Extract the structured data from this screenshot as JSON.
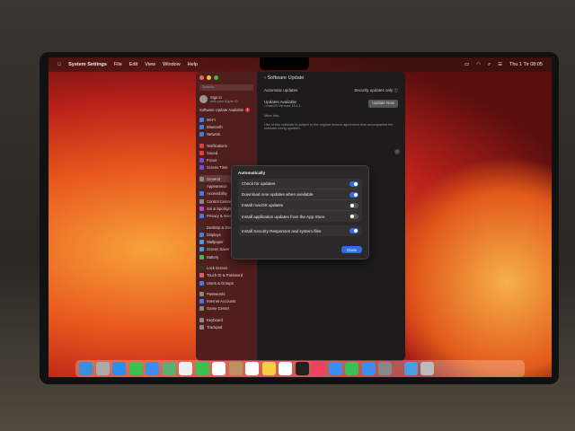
{
  "menubar": {
    "app": "System Settings",
    "items": [
      "File",
      "Edit",
      "View",
      "Window",
      "Help"
    ],
    "clock": "Thu 1 Tir 08:05"
  },
  "sidebar": {
    "search_placeholder": "Search",
    "sign_in": "Sign in",
    "sign_in_sub": "with your Apple ID",
    "update_available": "Software Update Available",
    "update_badge": "1",
    "items": [
      {
        "label": "Wi-Fi",
        "color": "#3a7bf0"
      },
      {
        "label": "Bluetooth",
        "color": "#3a7bf0"
      },
      {
        "label": "Network",
        "color": "#3a7bf0"
      },
      null,
      {
        "label": "Notifications",
        "color": "#e0403a"
      },
      {
        "label": "Sound",
        "color": "#e0403a"
      },
      {
        "label": "Focus",
        "color": "#6a4fd8"
      },
      {
        "label": "Screen Time",
        "color": "#6a4fd8"
      },
      null,
      {
        "label": "General",
        "color": "#888888"
      },
      {
        "label": "Appearance",
        "color": "#333333"
      },
      {
        "label": "Accessibility",
        "color": "#3a7bf0"
      },
      {
        "label": "Control Centre",
        "color": "#888888"
      },
      {
        "label": "Siri & Spotlight",
        "color": "#b04ad8"
      },
      {
        "label": "Privacy & Security",
        "color": "#3a7bf0"
      },
      null,
      {
        "label": "Desktop & Dock",
        "color": "#333333"
      },
      {
        "label": "Displays",
        "color": "#3a7bf0"
      },
      {
        "label": "Wallpaper",
        "color": "#3aa0e0"
      },
      {
        "label": "Screen Saver",
        "color": "#3aa0e0"
      },
      {
        "label": "Battery",
        "color": "#3ac050"
      },
      null,
      {
        "label": "Lock Screen",
        "color": "#333333"
      },
      {
        "label": "Touch ID & Password",
        "color": "#e06060"
      },
      {
        "label": "Users & Groups",
        "color": "#3a7bf0"
      },
      null,
      {
        "label": "Passwords",
        "color": "#888888"
      },
      {
        "label": "Internet Accounts",
        "color": "#3a7bf0"
      },
      {
        "label": "Game Center",
        "color": "#888888"
      },
      null,
      {
        "label": "Keyboard",
        "color": "#888888"
      },
      {
        "label": "Trackpad",
        "color": "#888888"
      }
    ]
  },
  "main": {
    "title": "Software Update",
    "auto_label": "Automatic updates",
    "auto_value": "Security updates only",
    "updates_label": "Updates Available",
    "updates_sub": "• macOS Ventura 13.4.1",
    "update_now": "Update Now",
    "more_info": "More Info...",
    "license_text": "Use of this software is subject to the original licence agreement that accompanied the software being updated.",
    "help": "?"
  },
  "dialog": {
    "heading": "Automatically",
    "rows": [
      {
        "label": "Check for updates",
        "on": true
      },
      {
        "label": "Download new updates when available",
        "on": true
      },
      {
        "label": "Install macOS updates",
        "on": false
      },
      {
        "label": "Install application updates from the App Store",
        "on": false
      }
    ],
    "security_row": {
      "label": "Install Security Responses and system files",
      "on": true
    },
    "done": "Done"
  },
  "dock": {
    "icons": [
      "finder",
      "launchpad",
      "safari",
      "messages",
      "mail",
      "maps",
      "photos",
      "facetime",
      "calendar",
      "contacts",
      "reminders",
      "notes",
      "freeform",
      "tv",
      "music",
      "keynote",
      "numbers",
      "app-store",
      "system-settings",
      "downloads",
      "trash"
    ],
    "colors": [
      "#3a8ee0",
      "#aaa",
      "#2a8ef0",
      "#3ac050",
      "#3a8ef0",
      "#5ab070",
      "#eee",
      "#3ac050",
      "#fff",
      "#c09060",
      "#fff",
      "#f7d040",
      "#fff",
      "#222",
      "#f04060",
      "#3a8ef0",
      "#3ac050",
      "#3a8ef0",
      "#888",
      "#4a9ee0",
      "#bbb"
    ],
    "badge": "1"
  }
}
